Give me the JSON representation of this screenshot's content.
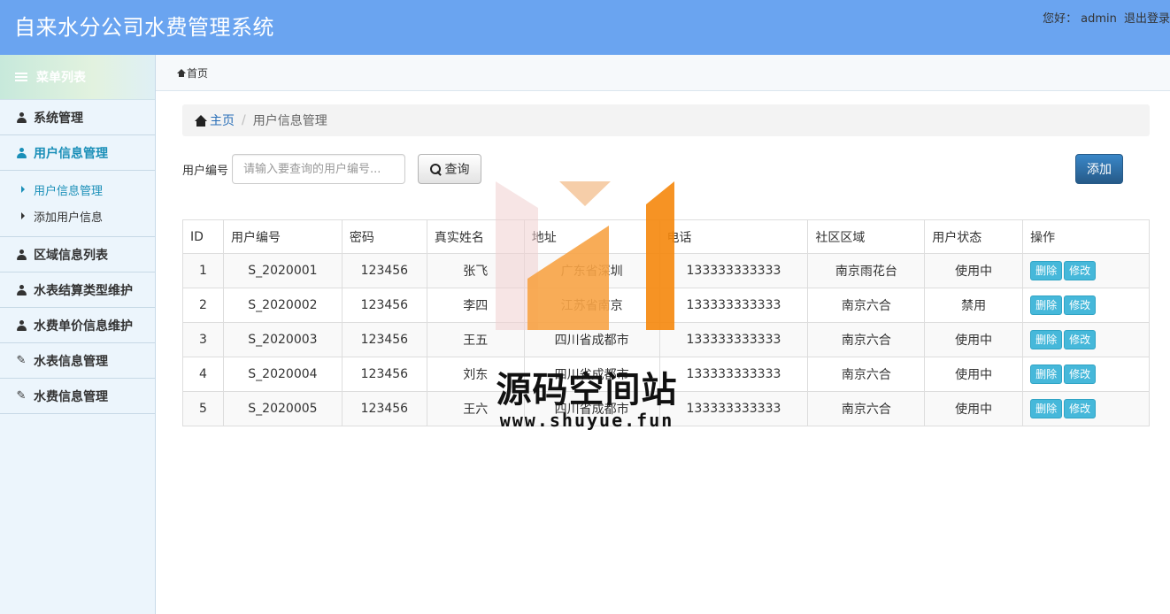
{
  "header": {
    "title": "自来水分公司水费管理系统",
    "greeting": "您好：",
    "username": "admin",
    "logout": "退出登录"
  },
  "sidebar": {
    "heading": "菜单列表",
    "items": [
      {
        "label": "系统管理",
        "icon": "user-icon"
      },
      {
        "label": "用户信息管理",
        "icon": "user-icon",
        "active": true
      },
      {
        "label": "区域信息列表",
        "icon": "user-icon"
      },
      {
        "label": "水表结算类型维护",
        "icon": "user-icon"
      },
      {
        "label": "水费单价信息维护",
        "icon": "user-icon"
      },
      {
        "label": "水表信息管理",
        "icon": "edit-icon"
      },
      {
        "label": "水费信息管理",
        "icon": "edit-icon"
      }
    ],
    "submenu": [
      {
        "label": "用户信息管理",
        "active": true
      },
      {
        "label": "添加用户信息"
      }
    ]
  },
  "topnav": {
    "home": "首页"
  },
  "breadcrumb": {
    "home": "主页",
    "current": "用户信息管理"
  },
  "search": {
    "label": "用户编号",
    "placeholder": "请输入要查询的用户编号...",
    "query_label": "查询",
    "add_label": "添加"
  },
  "table": {
    "headers": [
      "ID",
      "用户编号",
      "密码",
      "真实姓名",
      "地址",
      "电话",
      "社区区域",
      "用户状态",
      "操作"
    ],
    "rows": [
      [
        "1",
        "S_2020001",
        "123456",
        "张飞",
        "广东省深圳",
        "133333333333",
        "南京雨花台",
        "使用中"
      ],
      [
        "2",
        "S_2020002",
        "123456",
        "李四",
        "江苏省南京",
        "133333333333",
        "南京六合",
        "禁用"
      ],
      [
        "3",
        "S_2020003",
        "123456",
        "王五",
        "四川省成都市",
        "133333333333",
        "南京六合",
        "使用中"
      ],
      [
        "4",
        "S_2020004",
        "123456",
        "刘东",
        "四川省成都市",
        "133333333333",
        "南京六合",
        "使用中"
      ],
      [
        "5",
        "S_2020005",
        "123456",
        "王六",
        "四川省成都市",
        "133333333333",
        "南京六合",
        "使用中"
      ]
    ],
    "delete_label": "删除",
    "edit_label": "修改",
    "delete_color": "#46b8da"
  },
  "watermark": {
    "title": "源码空间站",
    "url": "www.shuyue.fun",
    "colors": [
      "#f0cfcf",
      "#f5c9a0",
      "#f7a345",
      "#f5870c"
    ]
  },
  "colors": {
    "header_bg": "#6aa4f0",
    "accent": "#1a8fb8",
    "link": "#2a6fb8",
    "primary_button": "#265a88"
  }
}
